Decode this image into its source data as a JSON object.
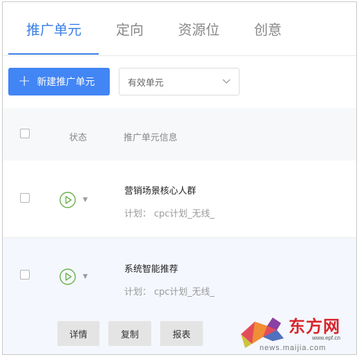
{
  "tabs": [
    {
      "label": "推广单元"
    },
    {
      "label": "定向"
    },
    {
      "label": "资源位"
    },
    {
      "label": "创意"
    }
  ],
  "toolbar": {
    "new_button_icon": "plus-icon",
    "new_button_label": "新建推广单元",
    "filter_value": "有效单元"
  },
  "table": {
    "headers": {
      "status": "状态",
      "info": "推广单元信息"
    },
    "rows": [
      {
        "name": "营销场景核心人群",
        "plan": "计划： cpc计划_无线_",
        "status_icon": "play-icon"
      },
      {
        "name": "系统智能推荐",
        "plan": "计划： cpc计划_无线_",
        "status_icon": "play-icon"
      }
    ],
    "row_actions": {
      "details": "详情",
      "copy": "复制",
      "report": "报表"
    }
  },
  "watermark": {
    "text": "东方网",
    "url_small": "www.epf.cn",
    "url": "news.maijia.com"
  },
  "colors": {
    "accent": "#4285f4",
    "status_green": "#6ab04c"
  }
}
